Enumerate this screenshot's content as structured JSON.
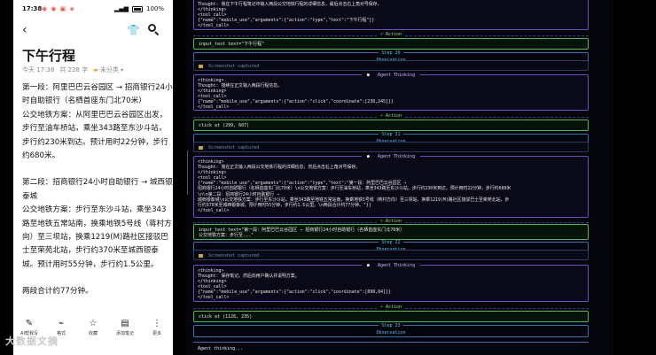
{
  "phone": {
    "status": {
      "time": "17:38",
      "notif_icons": "◉ ◉ ▣ ◈",
      "battery": "100%"
    },
    "title": "下午行程",
    "meta": {
      "datetime": "今天 17:38",
      "count": "共 228 字",
      "folder": "未分类"
    },
    "paragraphs": [
      "第一段：阿里巴巴云谷园区 → 招商银行24小时自助银行（名栖首座东门北70米）",
      "公交地铁方案：从阿里巴巴云谷园区出发，步行至油车桥站，乘坐343路至东沙斗站，步行约230米到达。预计用时22分钟，步行约680米。",
      "第二段：招商银行24小时自助银行 → 城西银泰城",
      "公交地铁方案：步行至东沙斗站，乘坐343路至地铁五常站南，换乘地铁5号线（蒋村方向）至三坝站，换乘1219(M)路社区接驳巴士至荣苑北站，步行约370米至城西银泰城。预计用时55分钟，步行约1.5公里。",
      "两段合计约77分钟。"
    ],
    "toolbar": [
      {
        "icon": "pen-icon",
        "glyph": "✎",
        "label": "AI帮我写"
      },
      {
        "icon": "brush-icon",
        "glyph": "⌁",
        "label": "格式"
      },
      {
        "icon": "star-icon",
        "glyph": "☆",
        "label": "收藏"
      },
      {
        "icon": "note-icon",
        "glyph": "▤",
        "label": "添加笔记"
      },
      {
        "icon": "more-icon",
        "glyph": "⋮",
        "label": "更多"
      }
    ],
    "watermark": "大数据文摘"
  },
  "log": {
    "block1": "Thought: 我在下午行程笔记中输入两段公交地铁行程的详细信息，最后点击右上角对号保存。\n</thinking>\n<tool_call>\n{\"name\":\"mobile_use\",\"arguments\":{\"action\":\"type\",\"text\":\"下午行程\"}}\n</tool_call>",
    "action_label": "⚡ Action",
    "action1": "input_text text=\"下午行程\"",
    "step20": "Step 20",
    "observation": "Observation",
    "screenshot_captured": "Screenshot captured",
    "agent_thinking": "Agent Thinking",
    "block2": "<thinking>\nThought: 接续在正文输入两段行程信息。\n</thinking>\n<tool_call>\n{\"name\":\"mobile_use\",\"arguments\":{\"action\":\"click\",\"coordinate\":[230,245]}}\n</tool_call>",
    "action2": "click at (299, 607)",
    "step21": "Step 21",
    "block3": "<thinking>\nThought: 我在正文输入两段公交地铁行程的详细信息，然后点击右上角对号保存。\n</thinking>\n<tool_call>\n{\"name\":\"mobile_use\",\"arguments\":{\"action\":\"type\",\"text\":\"第一段：阿里巴巴云谷园区 →\n招商银行24小时自助银行（名栖首座东门北70米）\\n公交地铁方案：步行至油车桥站，乘坐343路至东沙斗站，步行约230米到达。预计用时22分钟，步行约680米\n\\n\\n第二段：招商银行24小时自助银行 →\n城西银泰城\\n公交地铁方案：步行至东沙斗站，乘坐343路至地铁五常站南，换乘地铁5号线（蒋村方向）至三坝站，换乘1219(M)路社区接驳巴士至荣苑北站，步\n行约370米至城西银泰城。预计用时55分钟，步行约1.5公里。\\n两段合计约77分钟。\"}}\n</tool_call>",
    "action3": "input_text text=\"第一段：阿里巴巴云谷园区 → 招商银行24小时自助银行（名栖首座东门北70米）\n公交地铁方案：步行至...\"",
    "step22": "Step 22",
    "block4": "<thinking>\nThought: 保存笔记。然后向用户确认并说明方案。\n</thinking>\n<tool_call>\n{\"name\":\"mobile_use\",\"arguments\":{\"action\":\"click\",\"coordinate\":[898,84]}}\n</tool_call>",
    "action4": "click at (1126, 235)",
    "step23": "Step 23",
    "final": "Agent thinking..."
  }
}
